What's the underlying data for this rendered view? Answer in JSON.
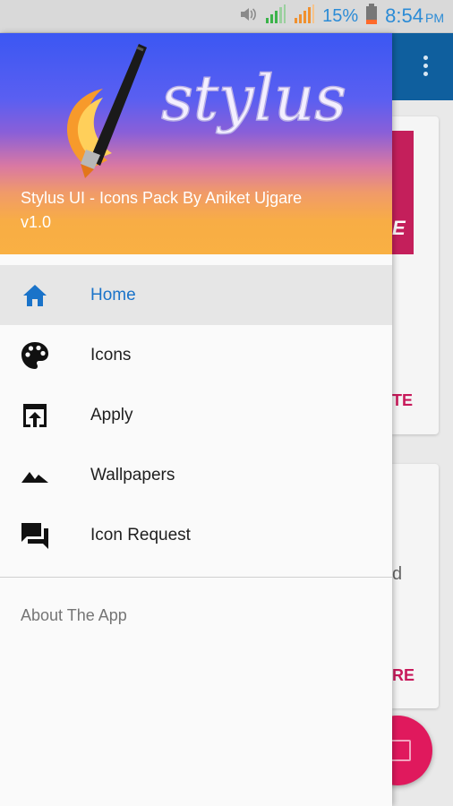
{
  "status_bar": {
    "battery_percent": "15%",
    "time": "8:54",
    "ampm": "PM",
    "icons": [
      "volume-icon",
      "signal-icon",
      "signal-icon",
      "battery-icon"
    ]
  },
  "drawer": {
    "header": {
      "logo_text": "stylus",
      "title": "Stylus UI - Icons Pack By Aniket Ujgare",
      "version": "v1.0"
    },
    "menu": [
      {
        "label": "Home",
        "icon": "home-icon",
        "active": true
      },
      {
        "label": "Icons",
        "icon": "palette-icon",
        "active": false
      },
      {
        "label": "Apply",
        "icon": "open-in-browser-icon",
        "active": false
      },
      {
        "label": "Wallpapers",
        "icon": "landscape-icon",
        "active": false
      },
      {
        "label": "Icon Request",
        "icon": "forum-icon",
        "active": false
      }
    ],
    "footer_item": "About The App"
  },
  "background": {
    "banner_fragment": "E",
    "card1_action_fragment": "TE",
    "card2_text_fragment": "d",
    "card2_action_fragment": "RE"
  },
  "colors": {
    "accent": "#1a73c9",
    "app_bar": "#0f5f9e",
    "fab": "#e0195d",
    "status_text": "#2b8bd6"
  }
}
